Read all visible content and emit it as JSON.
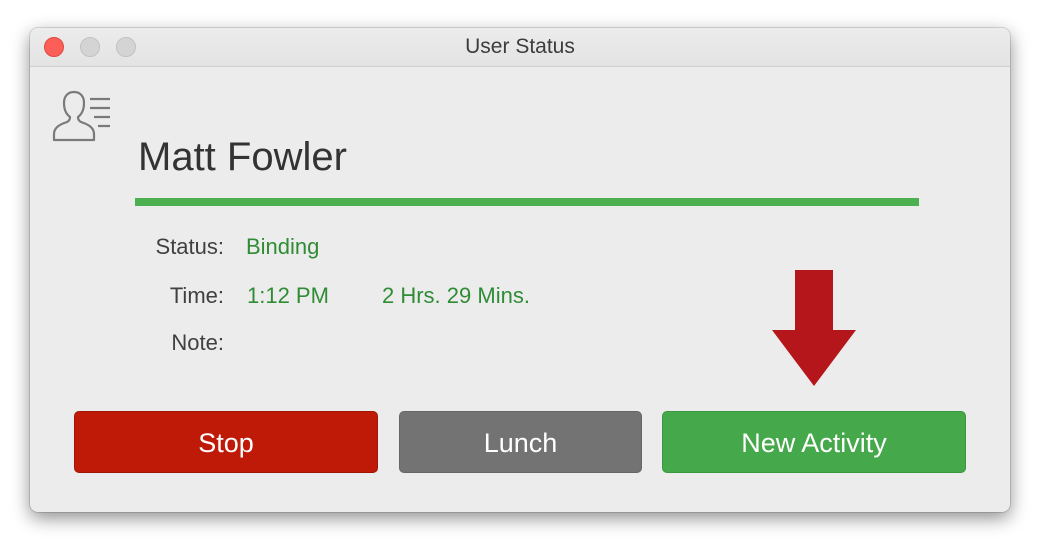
{
  "window": {
    "title": "User Status"
  },
  "user": {
    "name": "Matt Fowler"
  },
  "details": {
    "status_label": "Status:",
    "status_value": "Binding",
    "time_label": "Time:",
    "time_value": "1:12 PM",
    "duration_value": "2 Hrs. 29 Mins.",
    "note_label": "Note:",
    "note_value": ""
  },
  "buttons": {
    "stop": "Stop",
    "lunch": "Lunch",
    "new_activity": "New Activity"
  },
  "icons": {
    "user": "user-list-icon",
    "arrow": "down-arrow-icon"
  },
  "colors": {
    "accent_green": "#4caf50",
    "value_green": "#2f8c35",
    "stop_red": "#bf1a08",
    "lunch_gray": "#737373",
    "new_activity_green": "#45a84a",
    "arrow_red": "#b5161b"
  }
}
